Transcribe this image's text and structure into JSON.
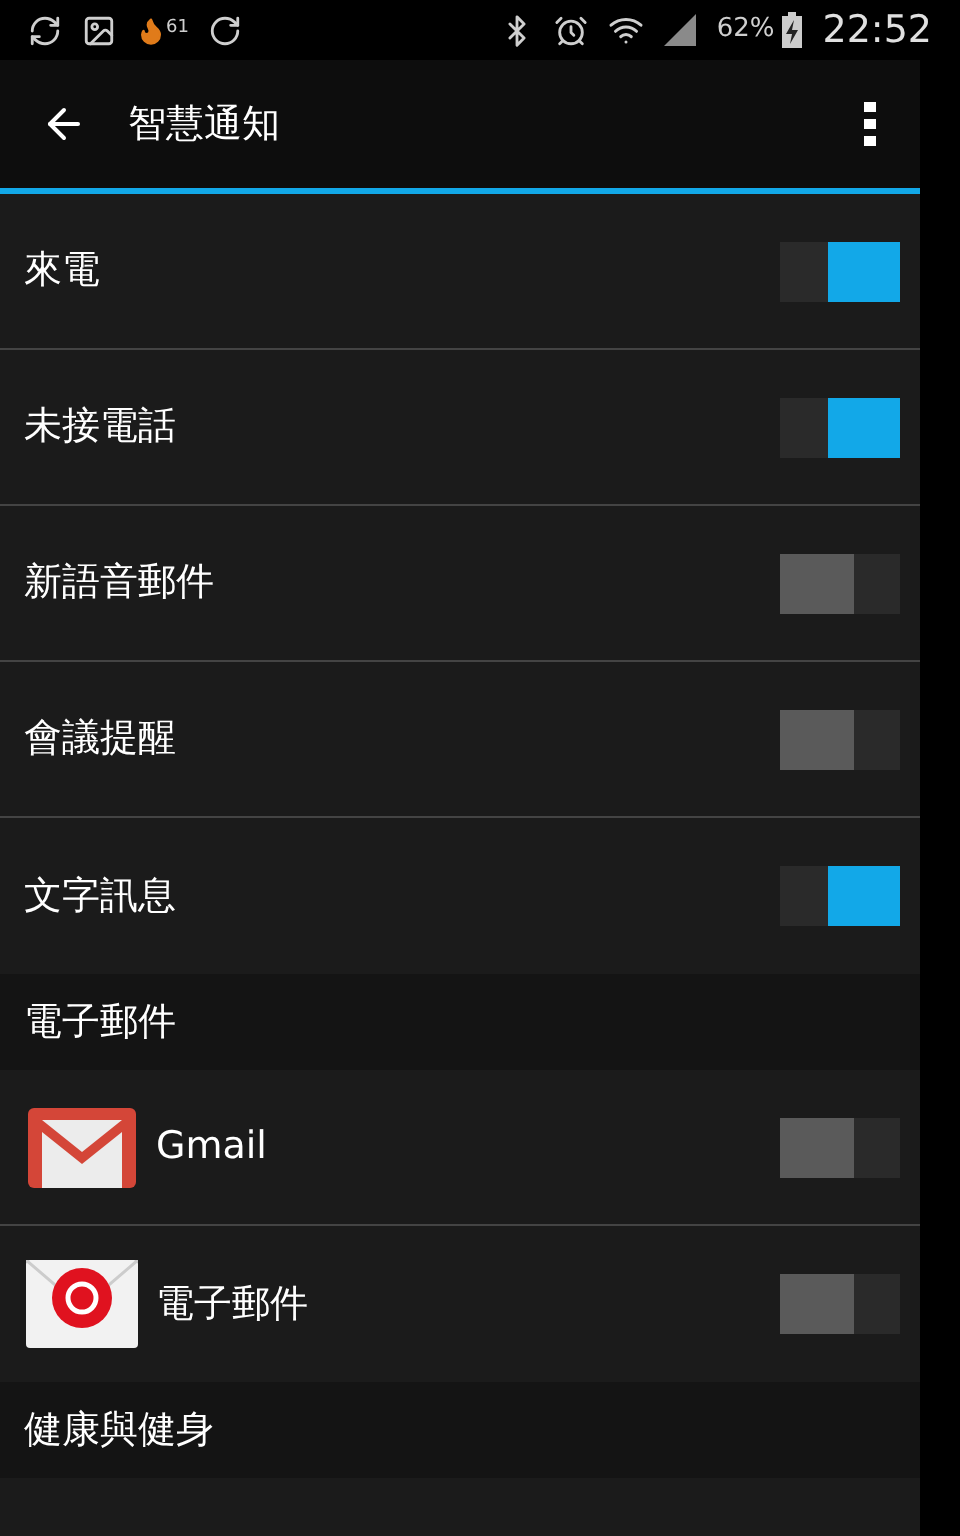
{
  "status_bar": {
    "notification_count": "61",
    "battery": "62%",
    "time": "22:52"
  },
  "app_bar": {
    "title": "智慧通知"
  },
  "items": [
    {
      "kind": "toggle",
      "label": "來電",
      "on": true
    },
    {
      "kind": "toggle",
      "label": "未接電話",
      "on": true
    },
    {
      "kind": "toggle",
      "label": "新語音郵件",
      "on": false
    },
    {
      "kind": "toggle",
      "label": "會議提醒",
      "on": false
    },
    {
      "kind": "toggle",
      "label": "文字訊息",
      "on": true
    },
    {
      "kind": "section",
      "label": "電子郵件"
    },
    {
      "kind": "gmail",
      "label": "Gmail",
      "on": false
    },
    {
      "kind": "email",
      "label": "電子郵件",
      "on": false
    },
    {
      "kind": "section",
      "label": "健康與健身"
    }
  ]
}
